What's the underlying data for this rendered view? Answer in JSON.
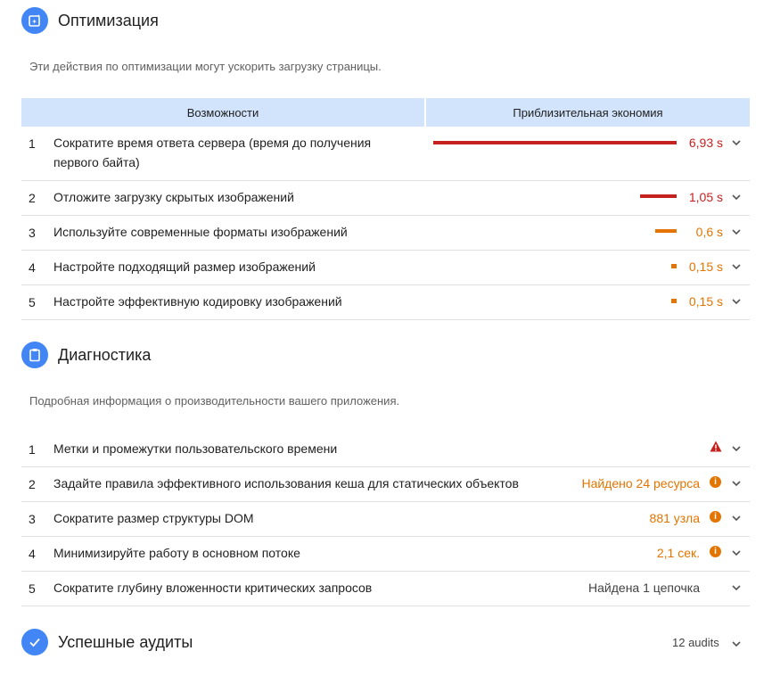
{
  "optimization": {
    "title": "Оптимизация",
    "icon": "optimization-icon",
    "description": "Эти действия по оптимизации могут ускорить загрузку страницы.",
    "col_opportunities": "Возможности",
    "col_savings": "Приблизительная экономия",
    "items": [
      {
        "num": "1",
        "label_line1": "Сократите время ответа сервера (время до получения",
        "label_line2": "первого байта)",
        "value": "6,93 s",
        "savings_fraction": 1.0,
        "color": "#c5221f"
      },
      {
        "num": "2",
        "label": "Отложите загрузку скрытых изображений",
        "value": "1,05 s",
        "savings_fraction": 0.152,
        "color": "#c5221f"
      },
      {
        "num": "3",
        "label": "Используйте современные форматы изображений",
        "value": "0,6 s",
        "savings_fraction": 0.087,
        "color": "#e37400"
      },
      {
        "num": "4",
        "label": "Настройте подходящий размер изображений",
        "value": "0,15 s",
        "savings_fraction": 0.022,
        "color": "#e37400"
      },
      {
        "num": "5",
        "label": "Настройте эффективную кодировку изображений",
        "value": "0,15 s",
        "savings_fraction": 0.022,
        "color": "#e37400"
      }
    ]
  },
  "diagnostics": {
    "title": "Диагностика",
    "icon": "clipboard-icon",
    "description": "Подробная информация о производительности вашего приложения.",
    "items": [
      {
        "num": "1",
        "label": "Метки и промежутки пользовательского времени",
        "value": "",
        "status_icon": "warning-icon",
        "color": "#c5221f"
      },
      {
        "num": "2",
        "label": "Задайте правила эффективного использования кеша для статических объектов",
        "value": "Найдено 24 ресурса",
        "status_icon": "info-icon",
        "color": "#e37400"
      },
      {
        "num": "3",
        "label": "Сократите размер структуры DOM",
        "value": "881 узла",
        "status_icon": "info-icon",
        "color": "#e37400"
      },
      {
        "num": "4",
        "label": "Минимизируйте работу в основном потоке",
        "value": "2,1 сек.",
        "status_icon": "info-icon",
        "color": "#e37400"
      },
      {
        "num": "5",
        "label": "Сократите глубину вложенности критических запросов",
        "value": "Найдена 1 цепочка",
        "status_icon": "",
        "color": "#424242"
      }
    ]
  },
  "passed": {
    "title": "Успешные аудиты",
    "icon": "checkmark-icon",
    "count": "12 audits"
  },
  "colors": {
    "accent": "#4285f4",
    "fail": "#c5221f",
    "average": "#e37400",
    "header_bg": "#d2e3fc"
  }
}
